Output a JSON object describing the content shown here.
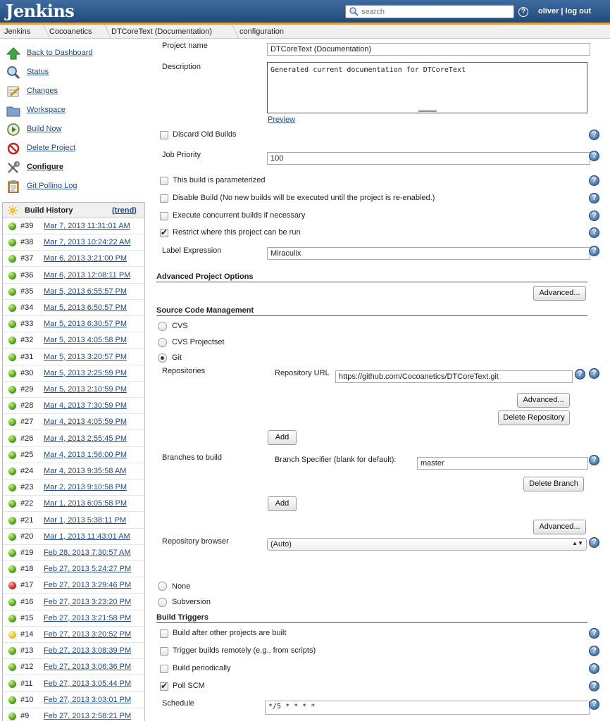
{
  "header": {
    "logo": "Jenkins",
    "search_placeholder": "search",
    "user": "oliver",
    "separator": "|",
    "logout": "log out"
  },
  "breadcrumb": [
    "Jenkins",
    "Cocoanetics",
    "DTCoreText (Documentation)",
    "configuration"
  ],
  "tasks": [
    {
      "label": "Back to Dashboard",
      "icon": "up-arrow-icon"
    },
    {
      "label": "Status",
      "icon": "magnifier-icon"
    },
    {
      "label": "Changes",
      "icon": "notepad-icon"
    },
    {
      "label": "Workspace",
      "icon": "folder-icon"
    },
    {
      "label": "Build Now",
      "icon": "clock-icon"
    },
    {
      "label": "Delete Project",
      "icon": "no-entry-icon"
    },
    {
      "label": "Configure",
      "icon": "wrench-icon"
    },
    {
      "label": "Git Polling Log",
      "icon": "clipboard-icon"
    }
  ],
  "build_history": {
    "title": "Build History",
    "trend": "trend",
    "builds": [
      {
        "num": "#39",
        "date": "Mar 7, 2013 11:31:01 AM",
        "status": "blue"
      },
      {
        "num": "#38",
        "date": "Mar 7, 2013 10:24:22 AM",
        "status": "blue"
      },
      {
        "num": "#37",
        "date": "Mar 6, 2013 3:21:00 PM",
        "status": "blue"
      },
      {
        "num": "#36",
        "date": "Mar 6, 2013 12:08:11 PM",
        "status": "blue"
      },
      {
        "num": "#35",
        "date": "Mar 5, 2013 6:55:57 PM",
        "status": "blue"
      },
      {
        "num": "#34",
        "date": "Mar 5, 2013 6:50:57 PM",
        "status": "blue"
      },
      {
        "num": "#33",
        "date": "Mar 5, 2013 6:30:57 PM",
        "status": "blue"
      },
      {
        "num": "#32",
        "date": "Mar 5, 2013 4:05:58 PM",
        "status": "blue"
      },
      {
        "num": "#31",
        "date": "Mar 5, 2013 3:20:57 PM",
        "status": "blue"
      },
      {
        "num": "#30",
        "date": "Mar 5, 2013 2:25:59 PM",
        "status": "blue"
      },
      {
        "num": "#29",
        "date": "Mar 5, 2013 2:10:59 PM",
        "status": "blue"
      },
      {
        "num": "#28",
        "date": "Mar 4, 2013 7:30:59 PM",
        "status": "blue"
      },
      {
        "num": "#27",
        "date": "Mar 4, 2013 4:05:59 PM",
        "status": "blue"
      },
      {
        "num": "#26",
        "date": "Mar 4, 2013 2:55:45 PM",
        "status": "blue"
      },
      {
        "num": "#25",
        "date": "Mar 4, 2013 1:56:00 PM",
        "status": "blue"
      },
      {
        "num": "#24",
        "date": "Mar 4, 2013 9:35:58 AM",
        "status": "blue"
      },
      {
        "num": "#23",
        "date": "Mar 2, 2013 9:10:58 PM",
        "status": "blue"
      },
      {
        "num": "#22",
        "date": "Mar 1, 2013 6:05:58 PM",
        "status": "blue"
      },
      {
        "num": "#21",
        "date": "Mar 1, 2013 5:38:11 PM",
        "status": "blue"
      },
      {
        "num": "#20",
        "date": "Mar 1, 2013 11:43:01 AM",
        "status": "blue"
      },
      {
        "num": "#19",
        "date": "Feb 28, 2013 7:30:57 AM",
        "status": "blue"
      },
      {
        "num": "#18",
        "date": "Feb 27, 2013 5:24:27 PM",
        "status": "blue"
      },
      {
        "num": "#17",
        "date": "Feb 27, 2013 3:29:46 PM",
        "status": "red"
      },
      {
        "num": "#16",
        "date": "Feb 27, 2013 3:23:20 PM",
        "status": "blue"
      },
      {
        "num": "#15",
        "date": "Feb 27, 2013 3:21:58 PM",
        "status": "blue"
      },
      {
        "num": "#14",
        "date": "Feb 27, 2013 3:20:52 PM",
        "status": "yellow"
      },
      {
        "num": "#13",
        "date": "Feb 27, 2013 3:08:39 PM",
        "status": "blue"
      },
      {
        "num": "#12",
        "date": "Feb 27, 2013 3:06:36 PM",
        "status": "blue"
      },
      {
        "num": "#11",
        "date": "Feb 27, 2013 3:05:44 PM",
        "status": "blue"
      },
      {
        "num": "#10",
        "date": "Feb 27, 2013 3:03:01 PM",
        "status": "blue"
      },
      {
        "num": "#9",
        "date": "Feb 27, 2013 2:58:21 PM",
        "status": "blue"
      }
    ]
  },
  "form": {
    "project_name_label": "Project name",
    "project_name": "DTCoreText (Documentation)",
    "description_label": "Description",
    "description": "Generated current documentation for DTCoreText",
    "preview": "Preview",
    "discard_old_builds": "Discard Old Builds",
    "job_priority_label": "Job Priority",
    "job_priority": "100",
    "parameterized": "This build is parameterized",
    "disable_build": "Disable Build (No new builds will be executed until the project is re-enabled.)",
    "concurrent": "Execute concurrent builds if necessary",
    "restrict": "Restrict where this project can be run",
    "label_expression_label": "Label Expression",
    "label_expression": "Miraculix",
    "advanced_options_title": "Advanced Project Options",
    "advanced": "Advanced...",
    "scm_title": "Source Code Management",
    "cvs": "CVS",
    "cvs_projectset": "CVS Projectset",
    "git": "Git",
    "repositories_label": "Repositories",
    "repo_url_label": "Repository URL",
    "repo_url": "https://github.com/Cocoanetics/DTCoreText.git",
    "delete_repository": "Delete Repository",
    "add": "Add",
    "branches_label": "Branches to build",
    "branch_spec_label": "Branch Specifier (blank for default):",
    "branch_spec": "master",
    "delete_branch": "Delete Branch",
    "repo_browser_label": "Repository browser",
    "repo_browser": "(Auto)",
    "none": "None",
    "subversion": "Subversion",
    "triggers_title": "Build Triggers",
    "after_other": "Build after other projects are built",
    "trigger_remote": "Trigger builds remotely (e.g., from scripts)",
    "build_periodically": "Build periodically",
    "poll_scm": "Poll SCM",
    "schedule_label": "Schedule",
    "schedule": "*/5 * * * *"
  }
}
